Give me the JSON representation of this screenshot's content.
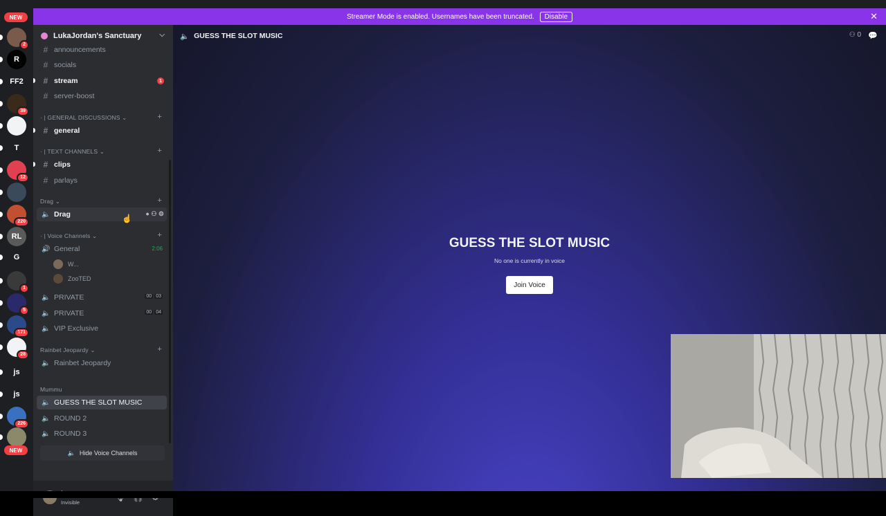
{
  "banner": {
    "text": "Streamer Mode is enabled. Usernames have been truncated.",
    "button": "Disable"
  },
  "rail": {
    "new_top": "NEW",
    "new_bottom": "NEW",
    "servers": [
      {
        "label": "",
        "badge": "2",
        "color": "#7a5a4a"
      },
      {
        "label": "R",
        "badge": "",
        "color": "#000000"
      },
      {
        "label": "FF2",
        "badge": "",
        "color": "#1e1f22"
      },
      {
        "label": "",
        "badge": "39",
        "color": "#3a2a1a"
      },
      {
        "label": "",
        "badge": "",
        "color": "#f2f3f5"
      },
      {
        "label": "T",
        "badge": "",
        "color": "#1e1f22"
      },
      {
        "label": "",
        "badge": "12",
        "color": "#e04050"
      },
      {
        "label": "",
        "badge": "",
        "color": "#3a4a5a"
      },
      {
        "label": "",
        "badge": "220",
        "color": "#c05030"
      },
      {
        "label": "RL",
        "badge": "",
        "color": "#5a5a5a"
      },
      {
        "label": "G",
        "badge": "",
        "color": "#1e1f22"
      },
      {
        "label": "",
        "badge": "1",
        "color": "#3a3a3a"
      },
      {
        "label": "",
        "badge": "5",
        "color": "#2a2a6a"
      },
      {
        "label": "",
        "badge": "171",
        "color": "#2a4a8a"
      },
      {
        "label": "",
        "badge": "28",
        "color": "#f2f3f5"
      },
      {
        "label": "js",
        "badge": "",
        "color": "#1e1f22"
      },
      {
        "label": "js",
        "badge": "",
        "color": "#1e1f22"
      },
      {
        "label": "",
        "badge": "226",
        "color": "#3a70c0"
      },
      {
        "label": "",
        "badge": "",
        "color": "#8a8a6a"
      }
    ]
  },
  "sidebar": {
    "server_name": "LukaJordan's Sanctuary",
    "channels": {
      "announcements": "announcements",
      "socials": "socials",
      "stream": "stream",
      "stream_badge": "1",
      "server_boost": "server-boost",
      "cat_general": "· | GENERAL DISCUSSIONS",
      "general": "general",
      "cat_text": "· | TEXT CHANNELS",
      "clips": "clips",
      "parlays": "parlays",
      "cat_drag": "Drag",
      "drag": "Drag",
      "cat_voice": "· | Voice Channels",
      "general_voice": "General",
      "general_timer": "2:06",
      "voice_user_1": "W...",
      "voice_user_2": "ZooTED",
      "private_1": "PRIVATE",
      "private_1_limit_a": "00",
      "private_1_limit_b": "03",
      "private_2": "PRIVATE",
      "private_2_limit_a": "00",
      "private_2_limit_b": "04",
      "vip": "VIP Exclusive",
      "cat_rainbet": "Rainbet Jeopardy",
      "rainbet": "Rainbet Jeopardy",
      "cat_mummu": "Mummu",
      "guess": "GUESS THE SLOT MUSIC",
      "round2": "ROUND 2",
      "round3": "ROUND 3"
    },
    "hide_voice": "Hide Voice Channels",
    "user": {
      "name": "jp",
      "status": "Invisible"
    }
  },
  "main": {
    "channel_title": "GUESS THE SLOT MUSIC",
    "member_count": "0",
    "voice_title": "GUESS THE SLOT MUSIC",
    "voice_subtitle": "No one is currently in voice",
    "join_label": "Join Voice"
  }
}
